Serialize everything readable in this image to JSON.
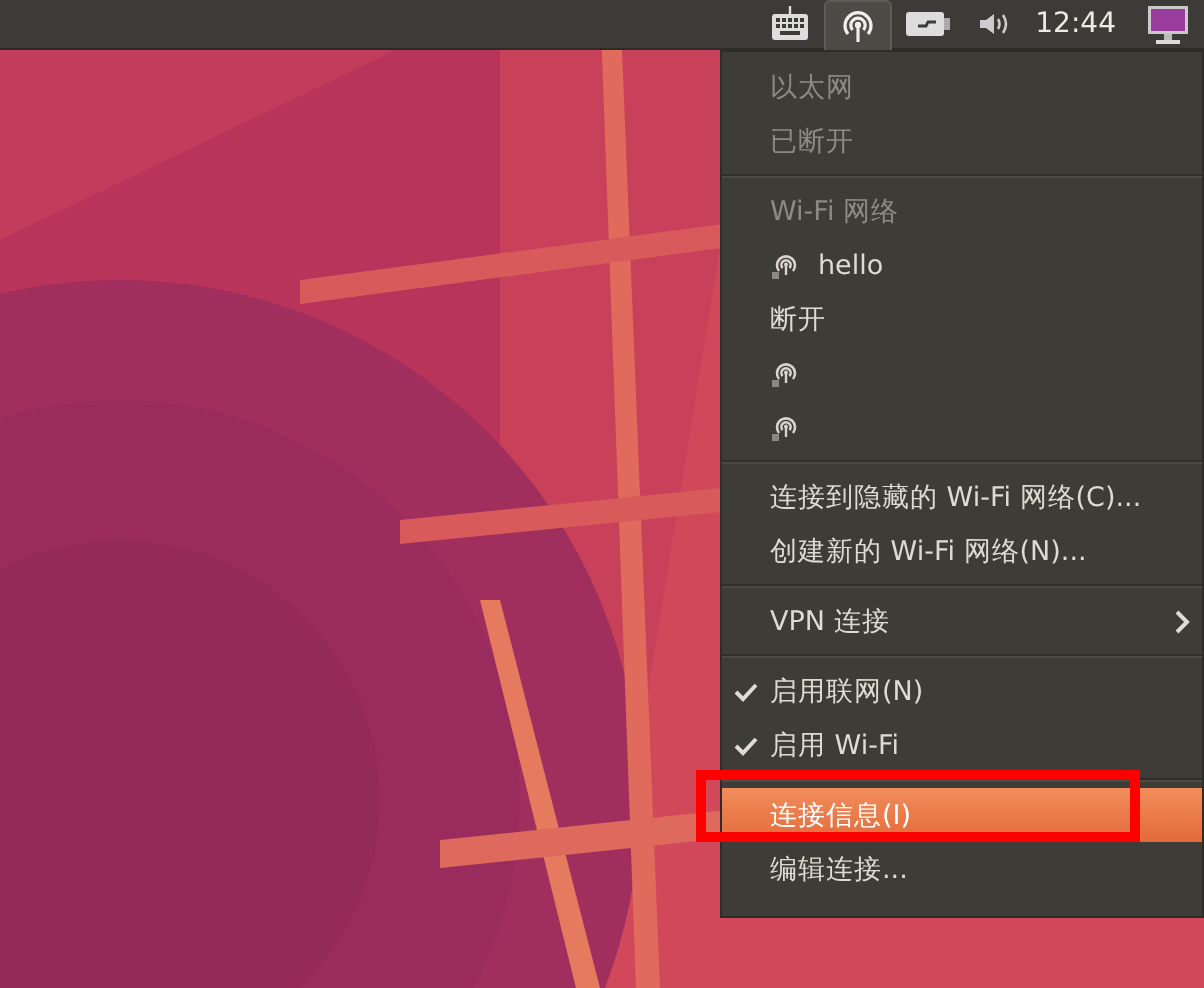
{
  "panel": {
    "indicators": [
      {
        "kind": "keyboard",
        "selected": false
      },
      {
        "kind": "wifi",
        "selected": true
      },
      {
        "kind": "battery",
        "selected": false
      },
      {
        "kind": "volume",
        "selected": false
      }
    ],
    "clock": "12:44"
  },
  "menu": {
    "items": [
      {
        "kind": "header",
        "label": "以太网",
        "disabled": true,
        "selected": false
      },
      {
        "kind": "header",
        "label": "已断开",
        "disabled": true,
        "selected": false
      },
      {
        "kind": "separator"
      },
      {
        "kind": "header",
        "label": "Wi-Fi 网络",
        "disabled": true,
        "selected": false
      },
      {
        "kind": "network",
        "label": "hello",
        "disabled": false,
        "selected": false
      },
      {
        "kind": "action",
        "label": "断开",
        "disabled": false,
        "selected": false
      },
      {
        "kind": "network",
        "disabled": false,
        "selected": false
      },
      {
        "kind": "network",
        "disabled": false,
        "selected": false
      },
      {
        "kind": "separator"
      },
      {
        "kind": "action",
        "label": "连接到隐藏的 Wi-Fi 网络(C)...",
        "disabled": false,
        "selected": false
      },
      {
        "kind": "action",
        "label": "创建新的 Wi-Fi 网络(N)...",
        "disabled": false,
        "selected": false
      },
      {
        "kind": "separator"
      },
      {
        "kind": "submenu",
        "label": "VPN 连接",
        "disabled": false,
        "selected": false
      },
      {
        "kind": "separator"
      },
      {
        "kind": "check",
        "label": "启用联网(N)",
        "checked": true,
        "disabled": false,
        "selected": false
      },
      {
        "kind": "check",
        "label": "启用 Wi-Fi",
        "checked": true,
        "disabled": false,
        "selected": false
      },
      {
        "kind": "separator"
      },
      {
        "kind": "action",
        "label": "连接信息(I)",
        "disabled": false,
        "selected": true
      },
      {
        "kind": "action",
        "label": "编辑连接...",
        "disabled": false,
        "selected": false
      }
    ]
  }
}
